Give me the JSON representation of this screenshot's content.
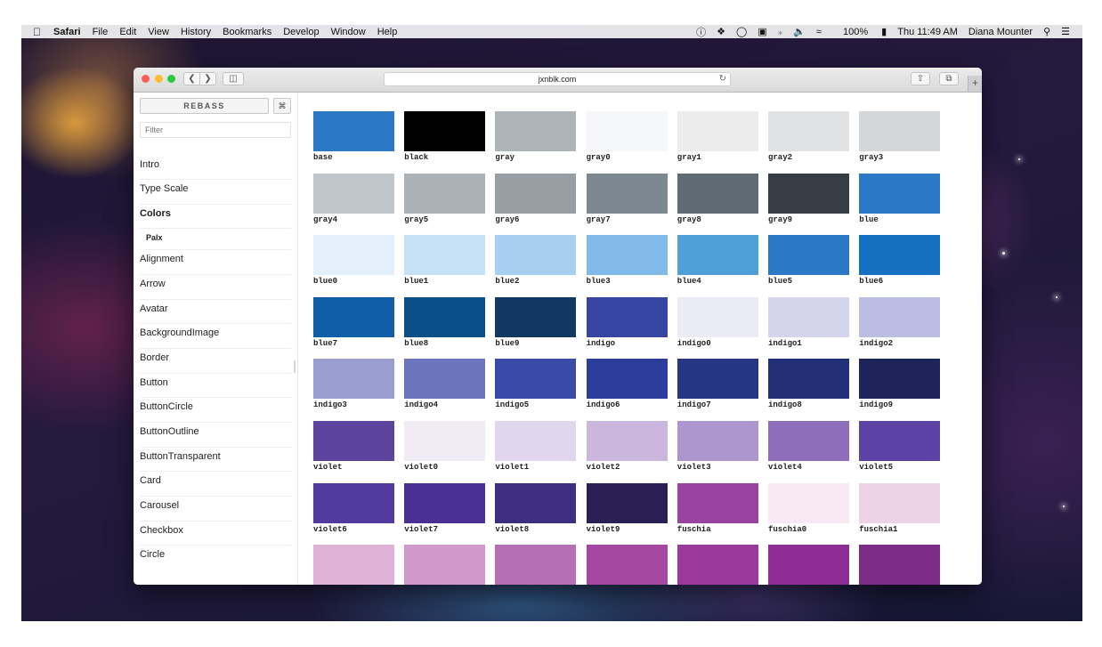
{
  "menubar": {
    "app_name": "Safari",
    "menus": [
      "File",
      "Edit",
      "View",
      "History",
      "Bookmarks",
      "Develop",
      "Window",
      "Help"
    ],
    "battery": "100%",
    "clock": "Thu 11:49 AM",
    "user": "Diana Mounter"
  },
  "browser": {
    "url": "jxnblk.com"
  },
  "sidebar": {
    "logo": "REBASS",
    "cmd": "⌘",
    "filter_placeholder": "Filter",
    "items": [
      {
        "label": "Intro"
      },
      {
        "label": "Type Scale"
      },
      {
        "label": "Colors"
      },
      {
        "label": "Palx"
      },
      {
        "label": "Alignment"
      },
      {
        "label": "Arrow"
      },
      {
        "label": "Avatar"
      },
      {
        "label": "BackgroundImage"
      },
      {
        "label": "Border"
      },
      {
        "label": "Button"
      },
      {
        "label": "ButtonCircle"
      },
      {
        "label": "ButtonOutline"
      },
      {
        "label": "ButtonTransparent"
      },
      {
        "label": "Card"
      },
      {
        "label": "Carousel"
      },
      {
        "label": "Checkbox"
      },
      {
        "label": "Circle"
      }
    ]
  },
  "swatches": [
    {
      "name": "base",
      "color": "#2a78c6"
    },
    {
      "name": "black",
      "color": "#000000"
    },
    {
      "name": "gray",
      "color": "#aeb5b9"
    },
    {
      "name": "gray0",
      "color": "#f6f7f8"
    },
    {
      "name": "gray1",
      "color": "#ececec"
    },
    {
      "name": "gray2",
      "color": "#e1e2e4"
    },
    {
      "name": "gray3",
      "color": "#d4d7da"
    },
    {
      "name": "gray4",
      "color": "#c1c6ca"
    },
    {
      "name": "gray5",
      "color": "#abb1b4"
    },
    {
      "name": "gray6",
      "color": "#979ea4"
    },
    {
      "name": "gray7",
      "color": "#7c8890"
    },
    {
      "name": "gray8",
      "color": "#5f6a73"
    },
    {
      "name": "gray9",
      "color": "#373d45"
    },
    {
      "name": "blue",
      "color": "#2a78c6"
    },
    {
      "name": "blue0",
      "color": "#e3f0fb"
    },
    {
      "name": "blue1",
      "color": "#c6e0f6"
    },
    {
      "name": "blue2",
      "color": "#a7cff0"
    },
    {
      "name": "blue3",
      "color": "#7fbae8"
    },
    {
      "name": "blue4",
      "color": "#4f9fd9"
    },
    {
      "name": "blue5",
      "color": "#2a78c6"
    },
    {
      "name": "blue6",
      "color": "#1570c1"
    },
    {
      "name": "blue7",
      "color": "#0f5fa8"
    },
    {
      "name": "blue8",
      "color": "#0b4f88"
    },
    {
      "name": "blue9",
      "color": "#103860"
    },
    {
      "name": "indigo",
      "color": "#3645a2"
    },
    {
      "name": "indigo0",
      "color": "#ebebf6"
    },
    {
      "name": "indigo1",
      "color": "#d4d5ed"
    },
    {
      "name": "indigo2",
      "color": "#bbbde3"
    },
    {
      "name": "indigo3",
      "color": "#999dd0"
    },
    {
      "name": "indigo4",
      "color": "#6c74be"
    },
    {
      "name": "indigo5",
      "color": "#3a4aa8"
    },
    {
      "name": "indigo6",
      "color": "#2c3d9c"
    },
    {
      "name": "indigo7",
      "color": "#273585"
    },
    {
      "name": "indigo8",
      "color": "#222e76"
    },
    {
      "name": "indigo9",
      "color": "#1d2358"
    },
    {
      "name": "violet",
      "color": "#5b439e"
    },
    {
      "name": "violet0",
      "color": "#f1ebf6"
    },
    {
      "name": "violet1",
      "color": "#e1d6ed"
    },
    {
      "name": "violet2",
      "color": "#cbb7de"
    },
    {
      "name": "violet3",
      "color": "#ad95cd"
    },
    {
      "name": "violet4",
      "color": "#8e6dba"
    },
    {
      "name": "violet5",
      "color": "#5c42a4"
    },
    {
      "name": "violet6",
      "color": "#533b9e"
    },
    {
      "name": "violet7",
      "color": "#4a2f94"
    },
    {
      "name": "violet8",
      "color": "#3e2e82"
    },
    {
      "name": "violet9",
      "color": "#2b2056"
    },
    {
      "name": "fuschia",
      "color": "#9a43a0"
    },
    {
      "name": "fuschia0",
      "color": "#f7eaf3"
    },
    {
      "name": "fuschia1",
      "color": "#eed3e6"
    },
    {
      "name": "",
      "color": "#dfb3d8"
    },
    {
      "name": "",
      "color": "#d098cb"
    },
    {
      "name": "",
      "color": "#b76fb4"
    },
    {
      "name": "",
      "color": "#a548a3"
    },
    {
      "name": "",
      "color": "#9b3a9c"
    },
    {
      "name": "",
      "color": "#8e2d96"
    },
    {
      "name": "",
      "color": "#7b2c85"
    }
  ]
}
